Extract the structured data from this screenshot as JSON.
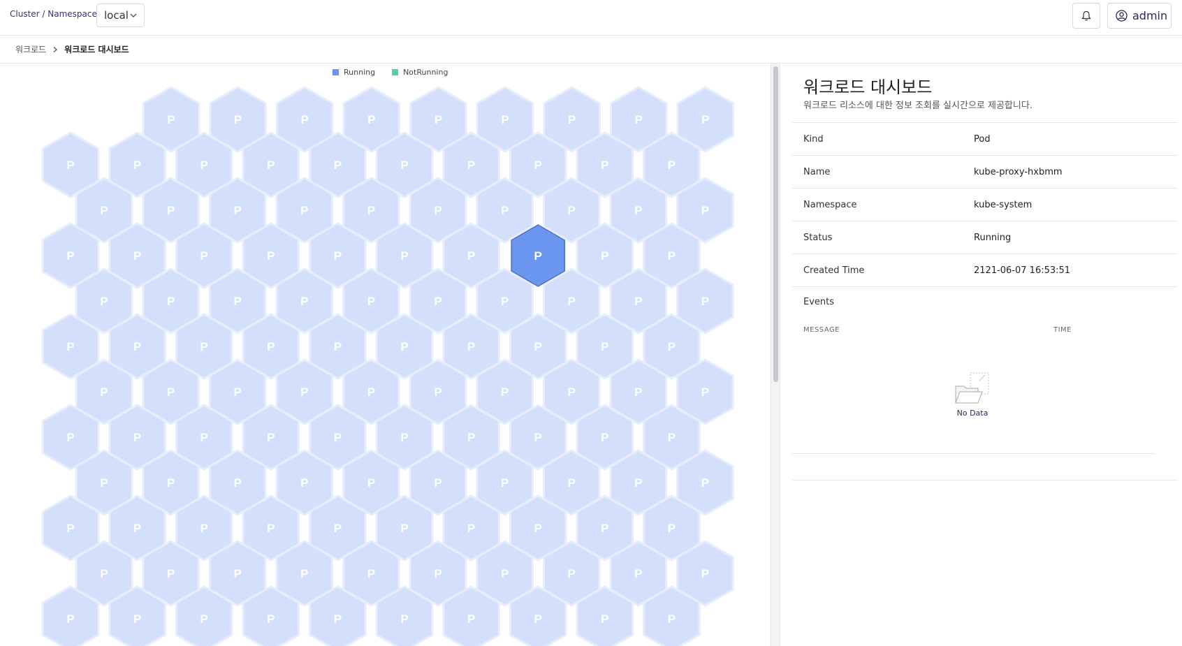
{
  "topbar": {
    "cluster_label": "Cluster / Namespace:",
    "namespace_value": "local",
    "user_name": "admin"
  },
  "breadcrumb": {
    "parent": "워크로드",
    "current": "워크로드 대시보드"
  },
  "legend": {
    "items": [
      {
        "label": "Running",
        "color": "#6b96f0"
      },
      {
        "label": "NotRunning",
        "color": "#4fd6a0"
      }
    ]
  },
  "hexmap": {
    "cell_label": "P",
    "cell_color": "#d4e0fb",
    "cell_stroke": "#e6edfd",
    "selected_color": "#6b96f0",
    "selected_stroke": "#4f6fc0",
    "rows": [
      {
        "count": 9,
        "offset": "right"
      },
      {
        "count": 10,
        "offset": "left"
      },
      {
        "count": 10,
        "offset": "mid"
      },
      {
        "count": 10,
        "offset": "left"
      },
      {
        "count": 10,
        "offset": "mid"
      },
      {
        "count": 10,
        "offset": "left"
      },
      {
        "count": 10,
        "offset": "mid"
      },
      {
        "count": 10,
        "offset": "left"
      },
      {
        "count": 10,
        "offset": "mid"
      },
      {
        "count": 10,
        "offset": "left"
      },
      {
        "count": 10,
        "offset": "mid"
      },
      {
        "count": 10,
        "offset": "left"
      }
    ],
    "selected": {
      "row": 3,
      "col": 7
    }
  },
  "detail": {
    "title": "워크로드 대시보드",
    "subtitle": "워크로드 리소스에 대한 정보 조회를 실시간으로 제공합니다.",
    "rows": [
      {
        "key": "Kind",
        "value": "Pod"
      },
      {
        "key": "Name",
        "value": "kube-proxy-hxbmm"
      },
      {
        "key": "Namespace",
        "value": "kube-system"
      },
      {
        "key": "Status",
        "value": "Running"
      },
      {
        "key": "Created Time",
        "value": "2121-06-07 16:53:51"
      }
    ],
    "events_label": "Events",
    "events_columns": {
      "message": "MESSAGE",
      "time": "TIME"
    },
    "empty_text": "No Data"
  }
}
